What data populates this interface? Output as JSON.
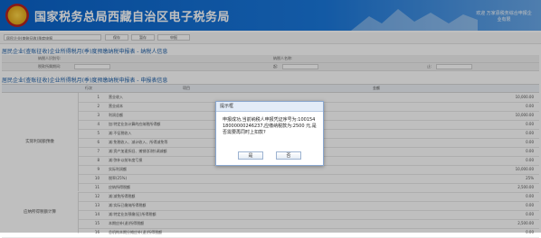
{
  "header": {
    "title": "国家税务总局西藏自治区电子税务局",
    "user_line1": "欢迎 万家县税务综合申报企",
    "user_line2": "业有限"
  },
  "toolbar": {
    "select_value": "居民企业(查账征收)季度申报",
    "buttons": [
      "保存",
      "暂存",
      "申报"
    ]
  },
  "sections": {
    "taxpayer_info": "居民企业(查账征收)企业所得税月(季)度预缴纳税申报表 - 纳税人信息",
    "taxpayer_id_label": "纳税人识别号:",
    "taxpayer_name_label": "纳税人名称:",
    "period_label": "税款所属期间:",
    "start_label": "起:",
    "end_label": "止:",
    "summary": "居民企业(查账征收)企业所得税月(季)度预缴纳税申报表 - 申报表信息"
  },
  "table": {
    "col_no": "行次",
    "col_item": "项目",
    "col_amount": "金额",
    "group1": "实际利润额预缴",
    "group2": "应纳所得税额计算",
    "rows": [
      {
        "no": "1",
        "item": "营业收入",
        "val": "10,000.00"
      },
      {
        "no": "2",
        "item": "营业成本",
        "val": "0.00"
      },
      {
        "no": "3",
        "item": "利润总额",
        "val": "10,000.00"
      },
      {
        "no": "4",
        "item": "加:特定业务计算的应纳税所得额",
        "val": "0.00"
      },
      {
        "no": "5",
        "item": "减:不征税收入",
        "val": "0.00"
      },
      {
        "no": "6",
        "item": "减:免税收入、减计收入、所得减免等",
        "val": "0.00"
      },
      {
        "no": "7",
        "item": "减:资产加速折旧、摊销(扣除)调减额",
        "val": "0.00"
      },
      {
        "no": "8",
        "item": "减:弥补以前年度亏损",
        "val": "0.00"
      },
      {
        "no": "9",
        "item": "实际利润额",
        "val": "10,000.00"
      },
      {
        "no": "10",
        "item": "税率(25%)",
        "val": "25%"
      },
      {
        "no": "11",
        "item": "应纳所得税额",
        "val": "2,500.00"
      },
      {
        "no": "12",
        "item": "减:减免所得税额",
        "val": "0.00"
      },
      {
        "no": "13",
        "item": "减:实际已缴纳所得税额",
        "val": "0.00"
      },
      {
        "no": "14",
        "item": "减:特定业务预缴(征)所得税额",
        "val": "0.00"
      },
      {
        "no": "15",
        "item": "本期应补(退)所得税额",
        "val": "2,500.00"
      },
      {
        "no": "16",
        "item": "总机构本期分摊应补(退)所得税额",
        "val": "0.00"
      }
    ]
  },
  "dialog": {
    "title": "提示框",
    "message": "申报成功,当前纳税人申报凭证序号为:10015418000000246237,应缴纳税款为:2500 元,是否需要再同时上扣款?",
    "confirm": "是",
    "cancel": "否"
  }
}
